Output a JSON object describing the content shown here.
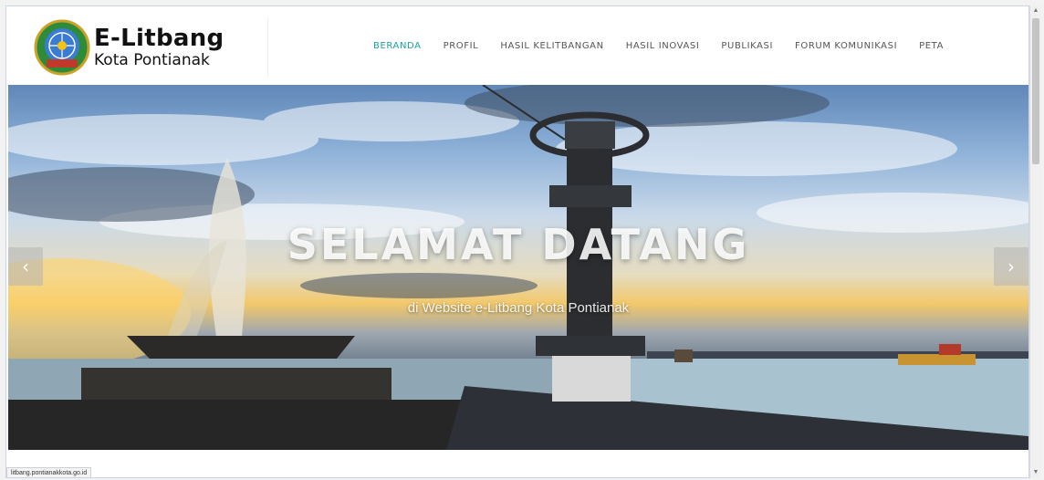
{
  "logo": {
    "title": "E-Litbang",
    "subtitle": "Kota Pontianak",
    "emblem": "city-emblem-icon"
  },
  "nav": {
    "items": [
      {
        "label": "BERANDA",
        "active": true
      },
      {
        "label": "PROFIL",
        "active": false
      },
      {
        "label": "HASIL KELITBANGAN",
        "active": false
      },
      {
        "label": "HASIL INOVASI",
        "active": false
      },
      {
        "label": "PUBLIKASI",
        "active": false
      },
      {
        "label": "FORUM KOMUNIKASI",
        "active": false
      },
      {
        "label": "PETA",
        "active": false
      }
    ],
    "active_color": "#1aa39a"
  },
  "hero": {
    "title": "SELAMAT DATANG",
    "subtitle": "di Website e-Litbang Kota Pontianak",
    "prev_icon": "chevron-left-icon",
    "next_icon": "chevron-right-icon"
  },
  "status_bar": {
    "url": "litbang.pontianakkota.go.id"
  }
}
